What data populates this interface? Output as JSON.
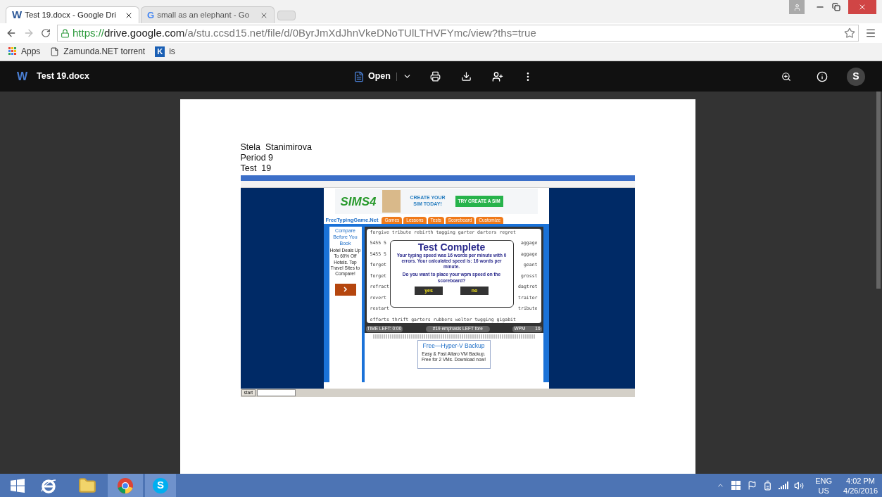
{
  "browser": {
    "tabs": [
      {
        "logo": "W",
        "kind": "word",
        "title": "Test 19.docx - Google Dri",
        "selected": true
      },
      {
        "logo": "G",
        "kind": "google",
        "title": "small as an elephant - Go",
        "selected": false
      }
    ],
    "url": {
      "scheme": "https://",
      "host": "drive.google.com",
      "path": "/a/stu.ccsd15.net/file/d/0ByrJmXdJhnVkeDNoTUlLTHVFYmc/view?ths=true"
    },
    "bookmarks": [
      {
        "kind": "apps",
        "label": "Apps"
      },
      {
        "kind": "page",
        "label": "Zamunda.NET torrent"
      },
      {
        "kind": "k",
        "logo": "K",
        "label": "is"
      }
    ]
  },
  "viewer": {
    "logo": "W",
    "file_name": "Test 19.docx",
    "open_label": "Open",
    "avatar": "S"
  },
  "document": {
    "lines": [
      "Stela  Stanimirova",
      "Period 9",
      "Test  19"
    ],
    "screenshot": {
      "ad_banner": {
        "logo": "SIMS4",
        "headline": "CREATE YOUR SIM TODAY!",
        "button": "TRY CREATE A SIM"
      },
      "site_name": "FreeTypingGame.Net",
      "nav": [
        "Games",
        "Lessons",
        "Tests",
        "Scoreboard",
        "Customize"
      ],
      "side_ad": {
        "title": "Compare Before You Book",
        "body": "Hotel Deals Up To 60% Off Hotels. Top Travel Sites to Compare!"
      },
      "typing_rows": [
        {
          "left": "forgive tribute rebirth tagging garter darters regret"
        },
        {
          "left": "5455 5",
          "right": "aggage"
        },
        {
          "left": "5455 5",
          "right": "aggage"
        },
        {
          "left": "forget",
          "right": "geant"
        },
        {
          "left": "forget",
          "right": "grosst"
        },
        {
          "left": "refract",
          "right": "dagtrot"
        },
        {
          "left": "revert",
          "right": "traitor"
        },
        {
          "left": "restart",
          "right": "tribute"
        },
        {
          "left": "efforts thrift garters rubbers wolter tugging gigabit"
        }
      ],
      "dialog": {
        "title": "Test Complete",
        "message": "Your typing speed was 16 words per minute with 0 errors. Your calculated speed is: 16 words per minute.",
        "question": "Do you want to place your wpm speed on the scoreboard?",
        "buttons": [
          "yes",
          "no"
        ]
      },
      "status": {
        "time_left": "TIME LEFT: 0:00",
        "lesson": "#19 emphasis LEFT fore",
        "wpm_label": "WPM",
        "wpm": "16"
      },
      "bottom_ad": {
        "title": "Free—Hyper-V Backup",
        "body": "Easy & Fast Altaro VM Backup. Free for 2 VMs. Download now!"
      },
      "start": "start"
    }
  },
  "taskbar": {
    "skype_logo": "S",
    "language": "ENG",
    "region": "US",
    "time": "4:02 PM",
    "date": "4/26/2016"
  }
}
